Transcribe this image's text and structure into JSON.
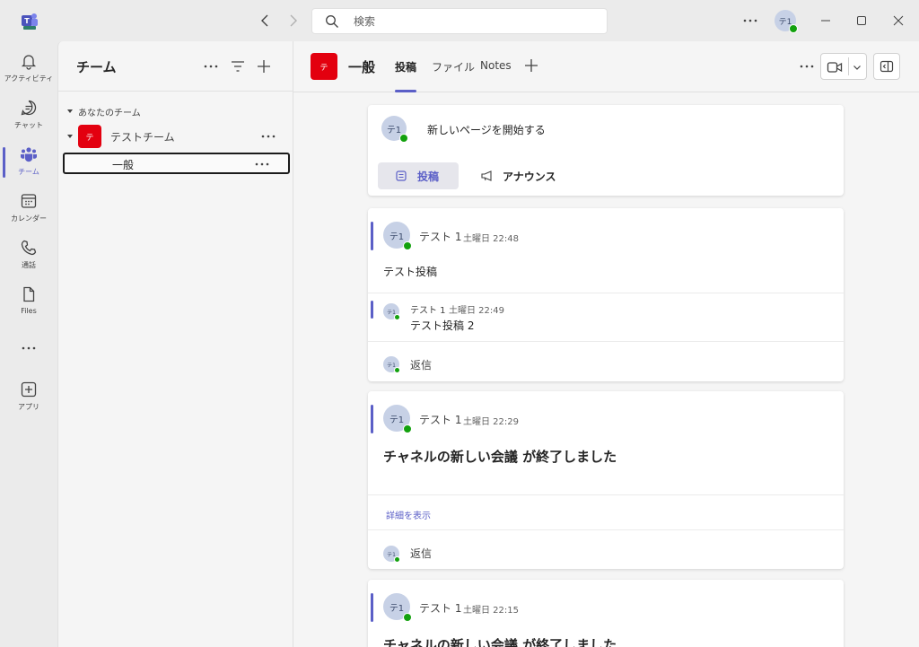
{
  "window": {
    "search_placeholder": "検索",
    "user_initials": "テ1"
  },
  "rail": {
    "items": [
      {
        "label": "アクティビティ",
        "icon": "bell-icon"
      },
      {
        "label": "チャット",
        "icon": "chat-icon"
      },
      {
        "label": "チーム",
        "icon": "teams-icon",
        "active": true
      },
      {
        "label": "カレンダー",
        "icon": "calendar-icon"
      },
      {
        "label": "通話",
        "icon": "phone-icon"
      },
      {
        "label": "Files",
        "icon": "file-icon"
      },
      {
        "label": "アプリ",
        "icon": "add-app-icon"
      }
    ]
  },
  "teams_panel": {
    "title": "チーム",
    "section_label": "あなたのチーム",
    "team": {
      "avatar": "テ",
      "name": "テストチーム",
      "avatar_color": "#e3000f"
    },
    "channel": {
      "name": "一般"
    }
  },
  "channel_header": {
    "avatar": "テ",
    "title": "一般",
    "tabs": [
      {
        "label": "投稿",
        "active": true
      },
      {
        "label": "ファイル"
      },
      {
        "label": "Notes"
      }
    ]
  },
  "compose": {
    "avatar": "テ1",
    "prompt": "新しいページを開始する",
    "post_button": "投稿",
    "announce_button": "アナウンス"
  },
  "posts": [
    {
      "avatar": "テ1",
      "author": "テスト 1",
      "time": "土曜日 22:48",
      "text": "テスト投稿",
      "reply": {
        "avatar": "テ1",
        "author": "テスト 1",
        "time": "土曜日 22:49",
        "text": "テスト投稿 2"
      },
      "reply_label": "返信"
    },
    {
      "avatar": "テ1",
      "author": "テスト 1",
      "time": "土曜日 22:29",
      "text": "チャネルの新しい会議 が終了しました",
      "details_label": "詳細を表示",
      "reply_label": "返信"
    },
    {
      "avatar": "テ1",
      "author": "テスト 1",
      "time": "土曜日 22:15",
      "text": "チャネルの新しい会議 が終了しました"
    }
  ],
  "colors": {
    "accent": "#5b5fc7",
    "team_red": "#e3000f",
    "presence": "#13a10e"
  }
}
